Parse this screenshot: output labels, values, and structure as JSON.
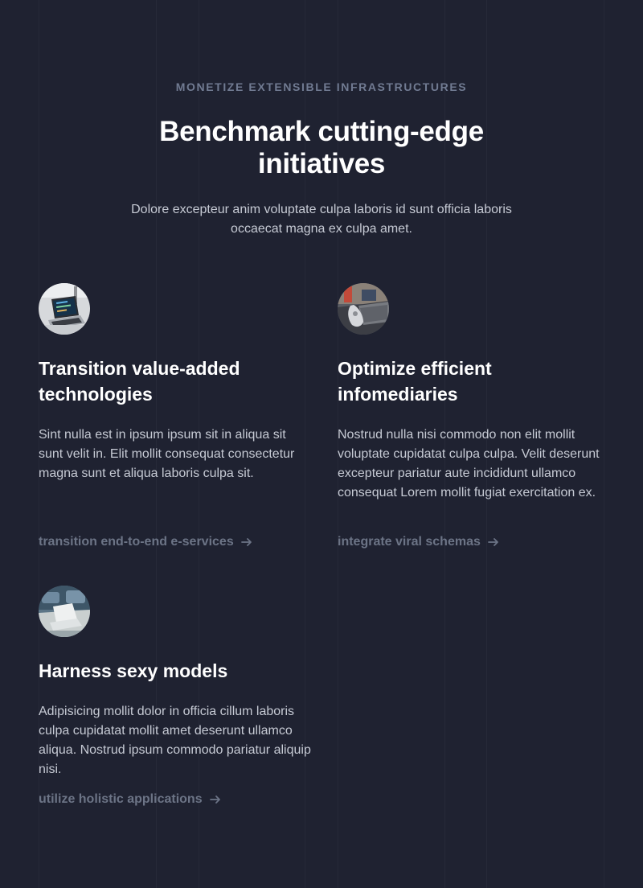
{
  "header": {
    "eyebrow": "MONETIZE EXTENSIBLE INFRASTRUCTURES",
    "title": "Benchmark cutting-edge initiatives",
    "subtitle": "Dolore excepteur anim voluptate culpa laboris id sunt officia laboris occaecat magna ex culpa amet."
  },
  "features": [
    {
      "title": "Transition value-added technologies",
      "text": "Sint nulla est in ipsum ipsum sit in aliqua sit sunt velit in. Elit mollit consequat consectetur magna sunt et aliqua laboris culpa sit.",
      "link": "transition end-to-end e-services"
    },
    {
      "title": "Optimize efficient infomediaries",
      "text": "Nostrud nulla nisi commodo non elit mollit voluptate cupidatat culpa culpa. Velit deserunt excepteur pariatur aute incididunt ullamco consequat Lorem mollit fugiat exercitation ex.",
      "link": "integrate viral schemas"
    },
    {
      "title": "Harness sexy models",
      "text": "Adipisicing mollit dolor in officia cillum laboris culpa cupidatat mollit amet deserunt ullamco aliqua. Nostrud ipsum commodo pariatur aliquip nisi.",
      "link": "utilize holistic applications"
    }
  ],
  "colors": {
    "background": "#1f2231",
    "heading": "#ffffff",
    "body_text": "#c6cad4",
    "muted": "#717b92",
    "link": "#6c7486"
  },
  "icons": {
    "link_arrow": "arrow-right-icon"
  }
}
